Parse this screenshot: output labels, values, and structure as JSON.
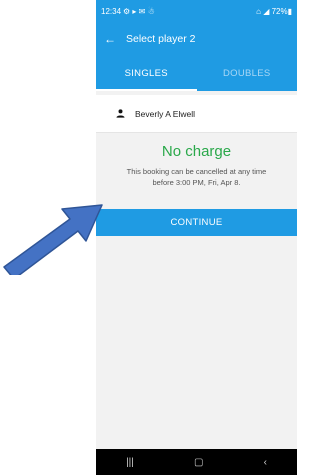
{
  "status_bar": {
    "time": "12:34",
    "left_icons": "⚙ ▸ ✉ ☃",
    "right_text": "⌂ ◢ 72%▮"
  },
  "app_bar": {
    "back_icon": "←",
    "title": "Select player 2"
  },
  "tabs": [
    {
      "label": "SINGLES",
      "active": true
    },
    {
      "label": "DOUBLES",
      "active": false
    }
  ],
  "player": {
    "name": "Beverly A Elwell",
    "icon": "person-icon"
  },
  "charge": {
    "title": "No charge",
    "note_line1": "This booking can be cancelled at any time",
    "note_line2": "before 3:00 PM, Fri, Apr 8."
  },
  "continue_label": "CONTINUE",
  "nav_bar": {
    "recents": "|||",
    "home": "▢",
    "back": "‹"
  },
  "colors": {
    "primary": "#1f9be3",
    "success": "#2aa84a",
    "annotation_arrow": "#4472c4"
  }
}
